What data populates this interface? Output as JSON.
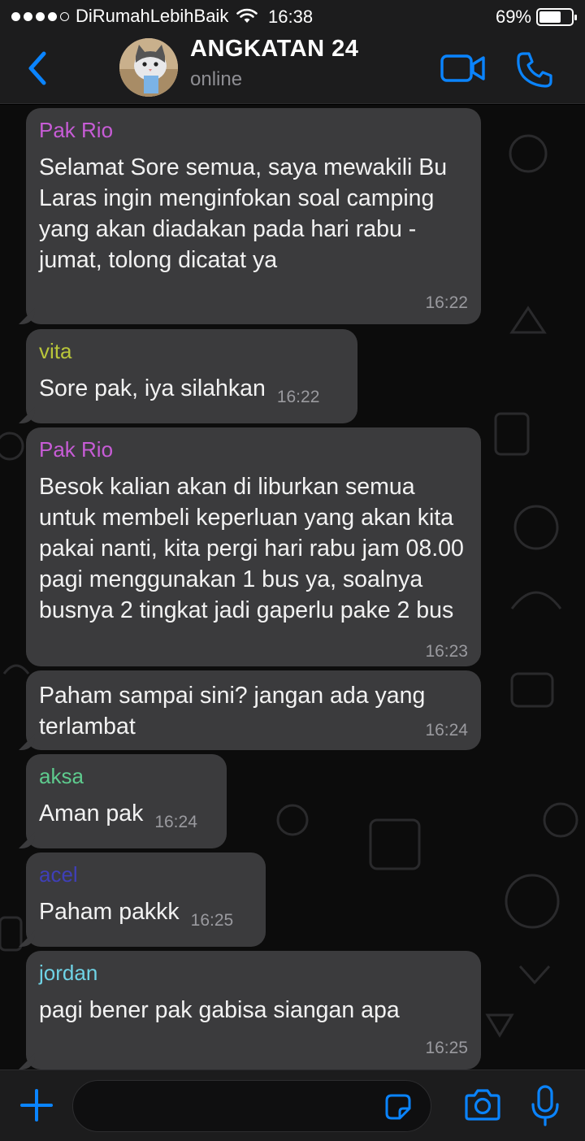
{
  "status_bar": {
    "carrier": "DiRumahLebihBaik",
    "time": "16:38",
    "battery_percent": "69%",
    "battery_level": 0.69,
    "icons": [
      "signal-dots-icon",
      "wifi-icon",
      "battery-icon"
    ]
  },
  "header": {
    "title": "ANGKATAN 24",
    "status": "online",
    "icons": [
      "back-chevron-icon",
      "group-avatar",
      "video-call-icon",
      "phone-call-icon"
    ]
  },
  "messages": [
    {
      "sender": "Pak Rio",
      "sender_color": "#c75cd6",
      "text": "Selamat Sore semua, saya mewakili Bu Laras ingin menginfokan soal camping yang akan diadakan pada hari rabu - jumat, tolong dicatat ya",
      "time": "16:22"
    },
    {
      "sender": "vita",
      "sender_color": "#b9c63a",
      "text": "Sore pak, iya silahkan",
      "time": "16:22"
    },
    {
      "sender": "Pak Rio",
      "sender_color": "#c75cd6",
      "text": "Besok kalian akan di liburkan semua untuk membeli keperluan yang akan kita pakai nanti, kita pergi hari rabu jam 08.00 pagi menggunakan 1 bus ya, soalnya busnya 2 tingkat jadi gaperlu pake 2 bus",
      "time": "16:23"
    },
    {
      "sender": "",
      "sender_color": "",
      "text": "Paham sampai sini? jangan ada yang terlambat",
      "time": "16:24"
    },
    {
      "sender": "aksa",
      "sender_color": "#5ecb8e",
      "text": "Aman pak",
      "time": "16:24"
    },
    {
      "sender": "acel",
      "sender_color": "#3f3fb8",
      "text": "Paham pakkk",
      "time": "16:25"
    },
    {
      "sender": "jordan",
      "sender_color": "#6fd3e6",
      "text": "pagi bener pak gabisa siangan apa",
      "time": "16:25"
    }
  ],
  "input_bar": {
    "placeholder": "",
    "icons": [
      "plus-icon",
      "sticker-icon",
      "camera-icon",
      "microphone-icon"
    ]
  },
  "colors": {
    "accent": "#0a84ff",
    "bubble": "#3b3b3d",
    "bar": "#1c1c1d"
  }
}
